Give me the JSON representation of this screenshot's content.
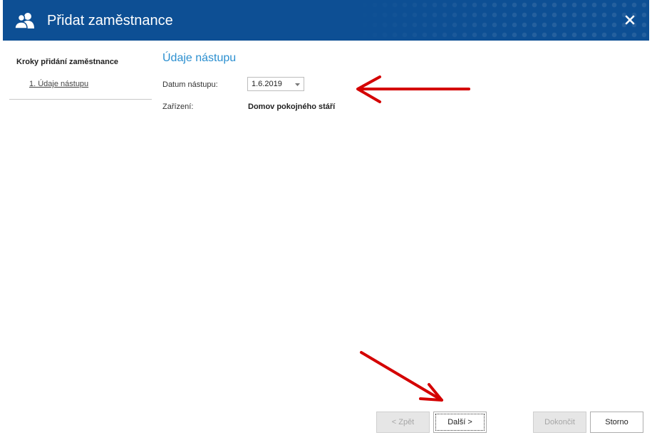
{
  "window": {
    "title": "Přidat zaměstnance",
    "icon": "users-icon",
    "close_icon": "close-icon",
    "accent_color": "#0d4f94"
  },
  "sidebar": {
    "heading": "Kroky přidání zaměstnance",
    "steps": [
      {
        "label": "1. Údaje nástupu"
      }
    ]
  },
  "main": {
    "section_title": "Údaje nástupu",
    "start_date": {
      "label": "Datum nástupu:",
      "value": "1.6.2019"
    },
    "facility": {
      "label": "Zařízení:",
      "value": "Domov pokojného stáří"
    }
  },
  "footer": {
    "back_label": "< Zpět",
    "next_label": "Další >",
    "finish_label": "Dokončit",
    "cancel_label": "Storno"
  },
  "annotation_color": "#d40000"
}
